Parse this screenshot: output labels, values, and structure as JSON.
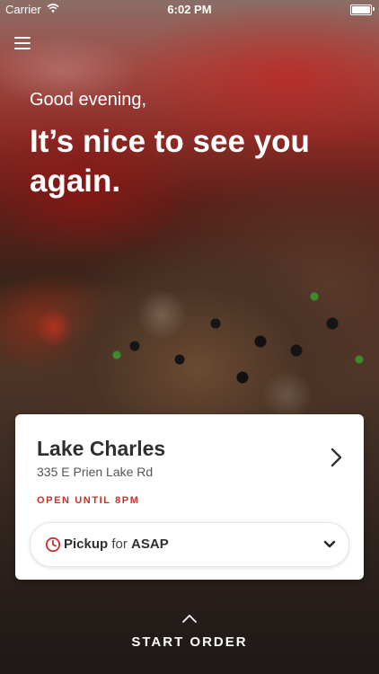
{
  "status_bar": {
    "carrier": "Carrier",
    "time": "6:02 PM"
  },
  "header": {
    "menu_icon": "hamburger-menu-icon"
  },
  "hero": {
    "greeting": "Good evening,",
    "headline": "It’s nice to see you again."
  },
  "store": {
    "name": "Lake Charles",
    "address": "335 E Prien Lake Rd",
    "hours": "OPEN UNTIL 8PM",
    "hours_color": "#c4312a"
  },
  "order_mode": {
    "mode": "Pickup",
    "connector": " for ",
    "time": "ASAP",
    "icon": "clock-icon"
  },
  "cta": {
    "label": "START ORDER"
  }
}
